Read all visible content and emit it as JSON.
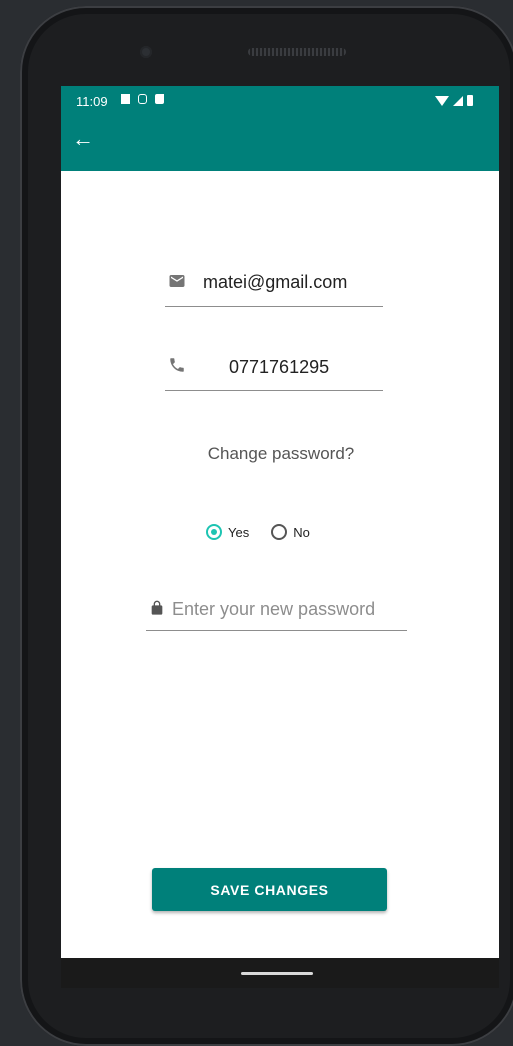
{
  "status_bar": {
    "time": "11:09"
  },
  "email": {
    "value": "matei@gmail.com"
  },
  "phone": {
    "value": "0771761295"
  },
  "password_question": "Change password?",
  "radio": {
    "yes_label": "Yes",
    "no_label": "No",
    "selected": "Yes"
  },
  "password": {
    "placeholder": "Enter your new password"
  },
  "save_button": "SAVE CHANGES",
  "colors": {
    "primary": "#00807a",
    "accent": "#1dc4b2"
  }
}
